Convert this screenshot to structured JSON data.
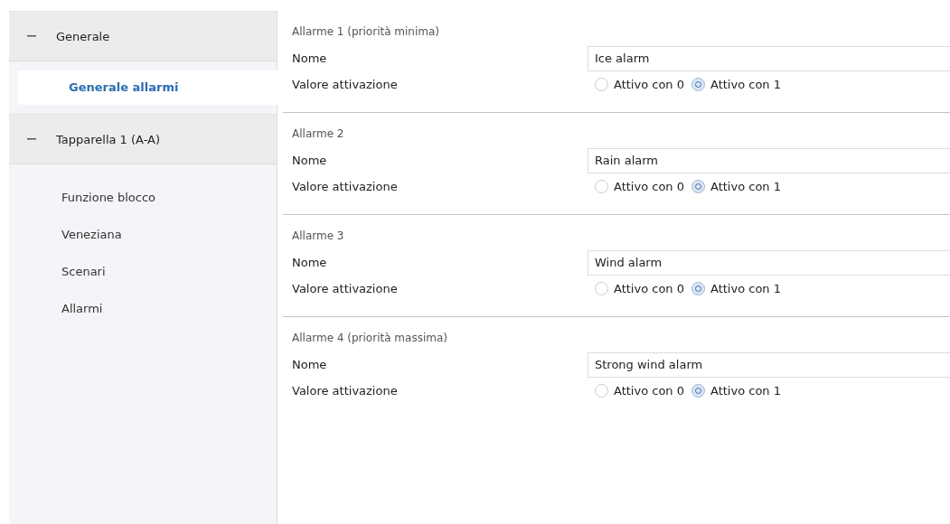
{
  "sidebar": {
    "groups": [
      {
        "label": "Generale",
        "expanded": true,
        "children": [
          {
            "label": "Generale allarmi",
            "selected": true
          }
        ]
      },
      {
        "label": "Tapparella 1 (A-A)",
        "expanded": true,
        "children": [
          {
            "label": "Funzione blocco",
            "selected": false
          },
          {
            "label": "Veneziana",
            "selected": false
          },
          {
            "label": "Scenari",
            "selected": false
          },
          {
            "label": "Allarmi",
            "selected": false
          }
        ]
      }
    ]
  },
  "sections": [
    {
      "title": "Allarme 1 (priorità minima)",
      "name_label": "Nome",
      "name_value": "Ice alarm",
      "activation_label": "Valore attivazione",
      "options": [
        {
          "label": "Attivo con 0",
          "selected": false
        },
        {
          "label": "Attivo con 1",
          "selected": true
        }
      ]
    },
    {
      "title": "Allarme 2",
      "name_label": "Nome",
      "name_value": "Rain alarm",
      "activation_label": "Valore attivazione",
      "options": [
        {
          "label": "Attivo con 0",
          "selected": false
        },
        {
          "label": "Attivo con 1",
          "selected": true
        }
      ]
    },
    {
      "title": "Allarme 3",
      "name_label": "Nome",
      "name_value": "Wind alarm",
      "activation_label": "Valore attivazione",
      "options": [
        {
          "label": "Attivo con 0",
          "selected": false
        },
        {
          "label": "Attivo con 1",
          "selected": true
        }
      ]
    },
    {
      "title": "Allarme 4 (priorità massima)",
      "name_label": "Nome",
      "name_value": "Strong wind alarm",
      "activation_label": "Valore attivazione",
      "options": [
        {
          "label": "Attivo con 0",
          "selected": false
        },
        {
          "label": "Attivo con 1",
          "selected": true
        }
      ]
    }
  ]
}
